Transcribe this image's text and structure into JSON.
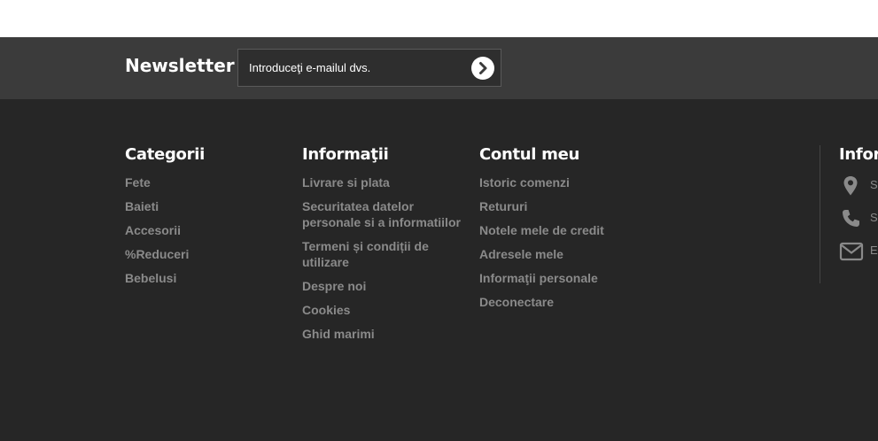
{
  "newsletter": {
    "title": "Newsletter",
    "placeholder": "Introduceţi e-mailul dvs."
  },
  "footer": {
    "categorii": {
      "title": "Categorii",
      "items": [
        "Fete",
        "Baieti",
        "Accesorii",
        "%Reduceri",
        "Bebelusi"
      ]
    },
    "informatii": {
      "title": "Informaţii",
      "items": [
        "Livrare si plata",
        "Securitatea datelor personale si a informatiilor",
        "Termeni și condiții de utilizare",
        "Despre noi",
        "Cookies",
        "Ghid marimi"
      ]
    },
    "contul_meu": {
      "title": "Contul meu",
      "items": [
        "Istoric comenzi",
        "Retururi",
        "Notele mele de credit",
        "Adresele mele",
        "Informaţii personale",
        "Deconectare"
      ]
    },
    "info": {
      "title": "Infor",
      "contacts": [
        {
          "icon": "map-marker-icon",
          "text": "S"
        },
        {
          "icon": "phone-icon",
          "text": "S"
        },
        {
          "icon": "envelope-icon",
          "text": "E"
        }
      ]
    }
  },
  "colors": {
    "footer_bg": "#262626",
    "newsletter_bg": "#3b3b3b",
    "link_color": "#8a8a8a",
    "heading_color": "#ffffff"
  }
}
